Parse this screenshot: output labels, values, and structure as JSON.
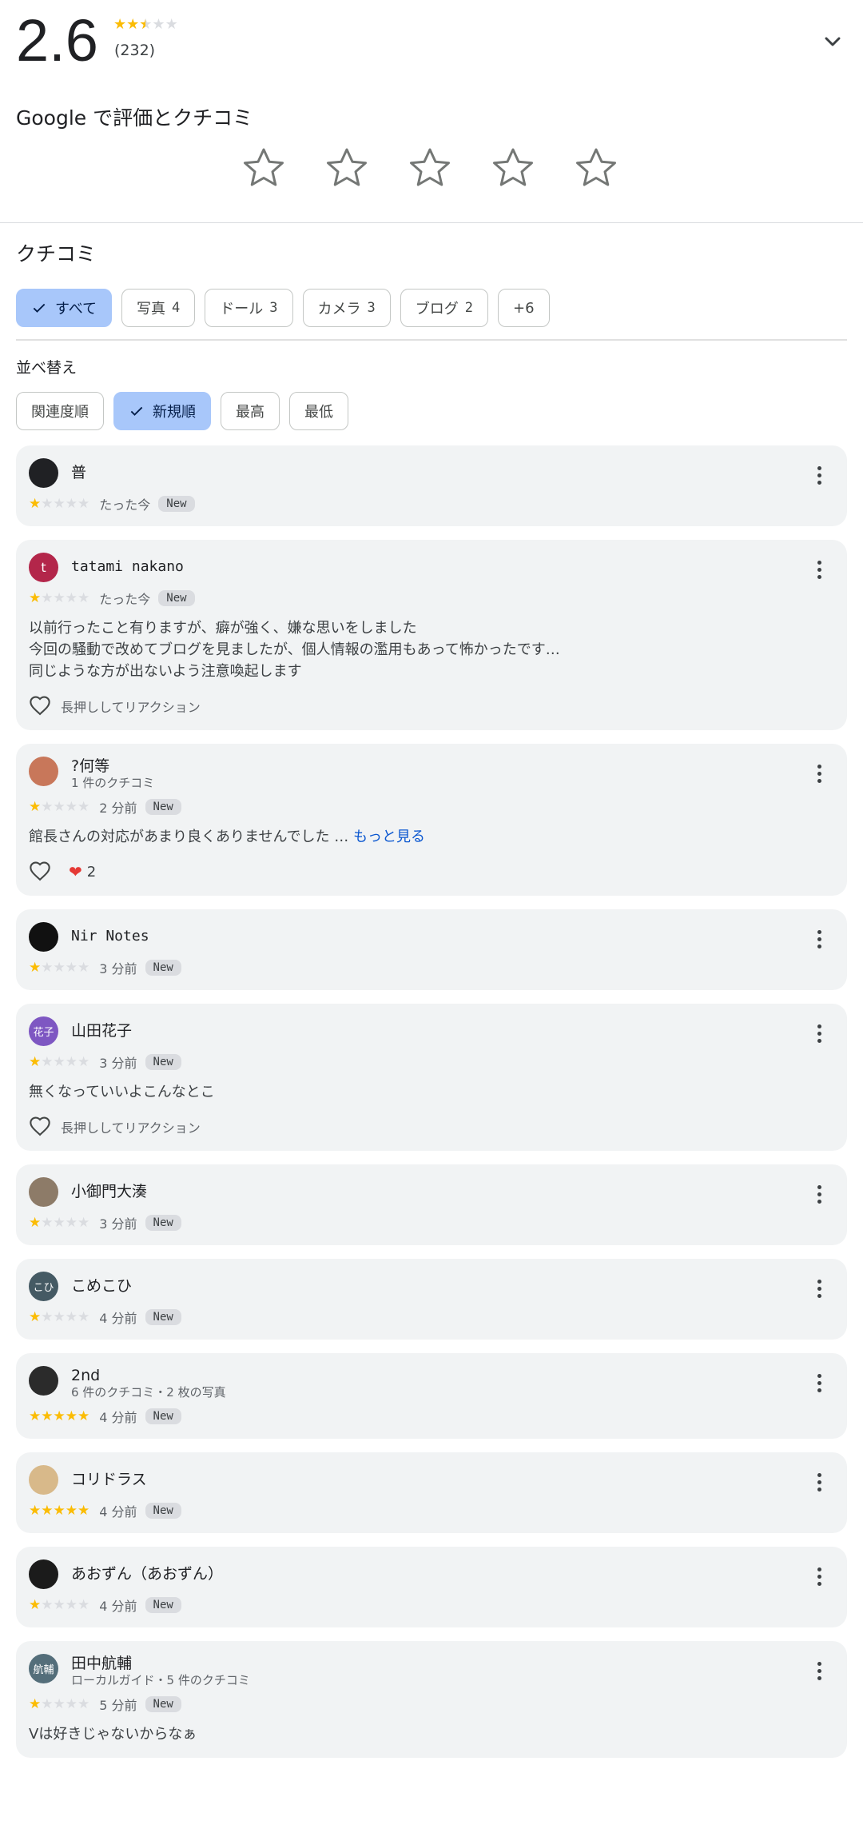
{
  "summary": {
    "rating": "2.6",
    "rating_value": 2.6,
    "count": "(232)"
  },
  "rate_section": {
    "title": "Google で評価とクチコミ",
    "star_count": 5
  },
  "reviews_section": {
    "title": "クチコミ",
    "filters": [
      {
        "label": "すべて",
        "count": "",
        "selected": true
      },
      {
        "label": "写真",
        "count": "4",
        "selected": false
      },
      {
        "label": "ドール",
        "count": "3",
        "selected": false
      },
      {
        "label": "カメラ",
        "count": "3",
        "selected": false
      },
      {
        "label": "ブログ",
        "count": "2",
        "selected": false
      },
      {
        "label": "+6",
        "count": "",
        "selected": false
      }
    ],
    "sort_label": "並べ替え",
    "sort_options": [
      {
        "label": "関連度順",
        "selected": false
      },
      {
        "label": "新規順",
        "selected": true
      },
      {
        "label": "最高",
        "selected": false
      },
      {
        "label": "最低",
        "selected": false
      }
    ]
  },
  "reviews": [
    {
      "name": "普",
      "sub": "",
      "stars": 1,
      "time": "たった今",
      "badge": "New",
      "text": "",
      "more": "",
      "reaction_hint": "",
      "reaction_count": "",
      "avatar_text": "",
      "avatar_color": "#202124",
      "mono": false
    },
    {
      "name": "tatami nakano",
      "sub": "",
      "stars": 1,
      "time": "たった今",
      "badge": "New",
      "text": "以前行ったこと有りますが、癖が強く、嫌な思いをしました\n今回の騒動で改めてブログを見ましたが、個人情報の濫用もあって怖かったです…\n同じような方が出ないよう注意喚起します",
      "more": "",
      "reaction_hint": "長押ししてリアクション",
      "reaction_count": "",
      "avatar_text": "t",
      "avatar_color": "#b3264a",
      "mono": true
    },
    {
      "name": "?何等",
      "sub": "1 件のクチコミ",
      "stars": 1,
      "time": "2 分前",
      "badge": "New",
      "text": "館長さんの対応があまり良くありませんでした …",
      "more": "もっと見る",
      "reaction_hint": "",
      "reaction_count": "2",
      "avatar_text": "",
      "avatar_color": "#c8775a",
      "mono": false
    },
    {
      "name": "Nir Notes",
      "sub": "",
      "stars": 1,
      "time": "3 分前",
      "badge": "New",
      "text": "",
      "more": "",
      "reaction_hint": "",
      "reaction_count": "",
      "avatar_text": "",
      "avatar_color": "#111111",
      "mono": true
    },
    {
      "name": "山田花子",
      "sub": "",
      "stars": 1,
      "time": "3 分前",
      "badge": "New",
      "text": "無くなっていいよこんなとこ",
      "more": "",
      "reaction_hint": "長押ししてリアクション",
      "reaction_count": "",
      "avatar_text": "花子",
      "avatar_color": "#7e57c2",
      "mono": false
    },
    {
      "name": "小御門大湊",
      "sub": "",
      "stars": 1,
      "time": "3 分前",
      "badge": "New",
      "text": "",
      "more": "",
      "reaction_hint": "",
      "reaction_count": "",
      "avatar_text": "",
      "avatar_color": "#8d7b68",
      "mono": false
    },
    {
      "name": "こめこひ",
      "sub": "",
      "stars": 1,
      "time": "4 分前",
      "badge": "New",
      "text": "",
      "more": "",
      "reaction_hint": "",
      "reaction_count": "",
      "avatar_text": "こひ",
      "avatar_color": "#455a64",
      "mono": false
    },
    {
      "name": "2nd",
      "sub": "6 件のクチコミ・2 枚の写真",
      "stars": 5,
      "time": "4 分前",
      "badge": "New",
      "text": "",
      "more": "",
      "reaction_hint": "",
      "reaction_count": "",
      "avatar_text": "",
      "avatar_color": "#2b2b2b",
      "mono": false
    },
    {
      "name": "コリドラス",
      "sub": "",
      "stars": 5,
      "time": "4 分前",
      "badge": "New",
      "text": "",
      "more": "",
      "reaction_hint": "",
      "reaction_count": "",
      "avatar_text": "",
      "avatar_color": "#d8b98a",
      "mono": false
    },
    {
      "name": "あおずん（あおずん）",
      "sub": "",
      "stars": 1,
      "time": "4 分前",
      "badge": "New",
      "text": "",
      "more": "",
      "reaction_hint": "",
      "reaction_count": "",
      "avatar_text": "",
      "avatar_color": "#1b1b1b",
      "mono": false
    },
    {
      "name": "田中航輔",
      "sub": "ローカルガイド・5 件のクチコミ",
      "stars": 1,
      "time": "5 分前",
      "badge": "New",
      "text": "Vは好きじゃないからなぁ",
      "more": "",
      "reaction_hint": "",
      "reaction_count": "",
      "avatar_text": "航輔",
      "avatar_color": "#546e7a",
      "mono": false
    }
  ]
}
